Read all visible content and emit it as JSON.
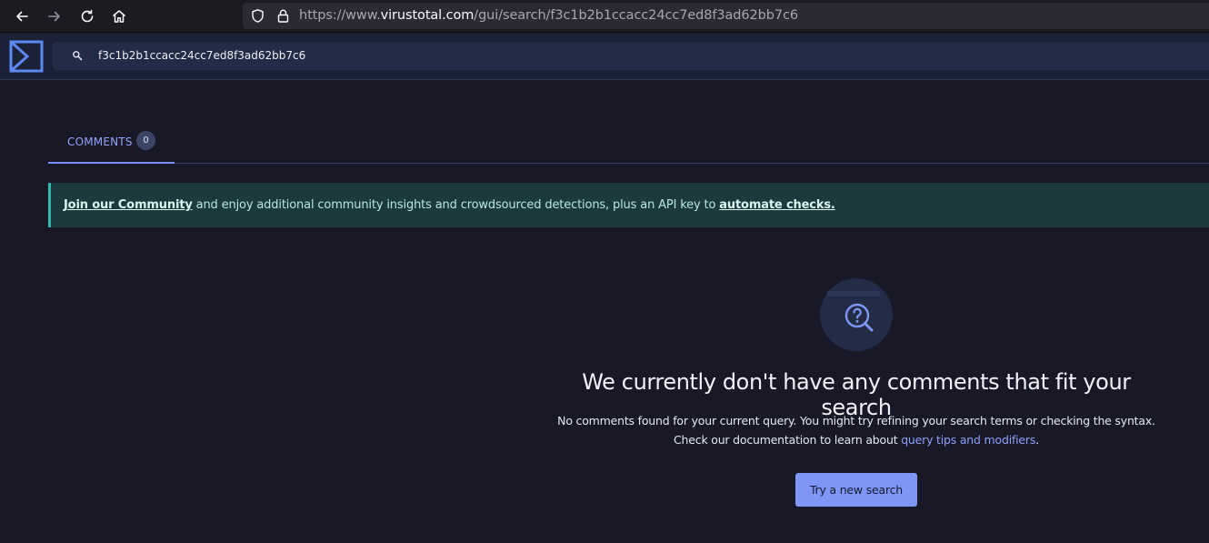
{
  "browser": {
    "url_prefix": "https://www.",
    "url_host": "virustotal.com",
    "url_path": "/gui/search/f3c1b2b1ccacc24cc7ed8f3ad62bb7c6"
  },
  "header": {
    "search_value": "f3c1b2b1ccacc24cc7ed8f3ad62bb7c6"
  },
  "tabs": [
    {
      "label": "COMMENTS",
      "count": "0"
    }
  ],
  "banner": {
    "link1": "Join our Community",
    "text": " and enjoy additional community insights and crowdsourced detections, plus an API key to ",
    "link2": "automate checks."
  },
  "empty_state": {
    "title": "We currently don't have any comments that fit your search",
    "line1": "No comments found for your current query. You might try refining your search terms or checking the syntax.",
    "line2_prefix": "Check our documentation to learn about ",
    "line2_link": "query tips and modifiers",
    "line2_suffix": ".",
    "button": "Try a new search"
  },
  "colors": {
    "accent": "#7f96f7",
    "background": "#181826",
    "banner": "#1c3a3d"
  }
}
